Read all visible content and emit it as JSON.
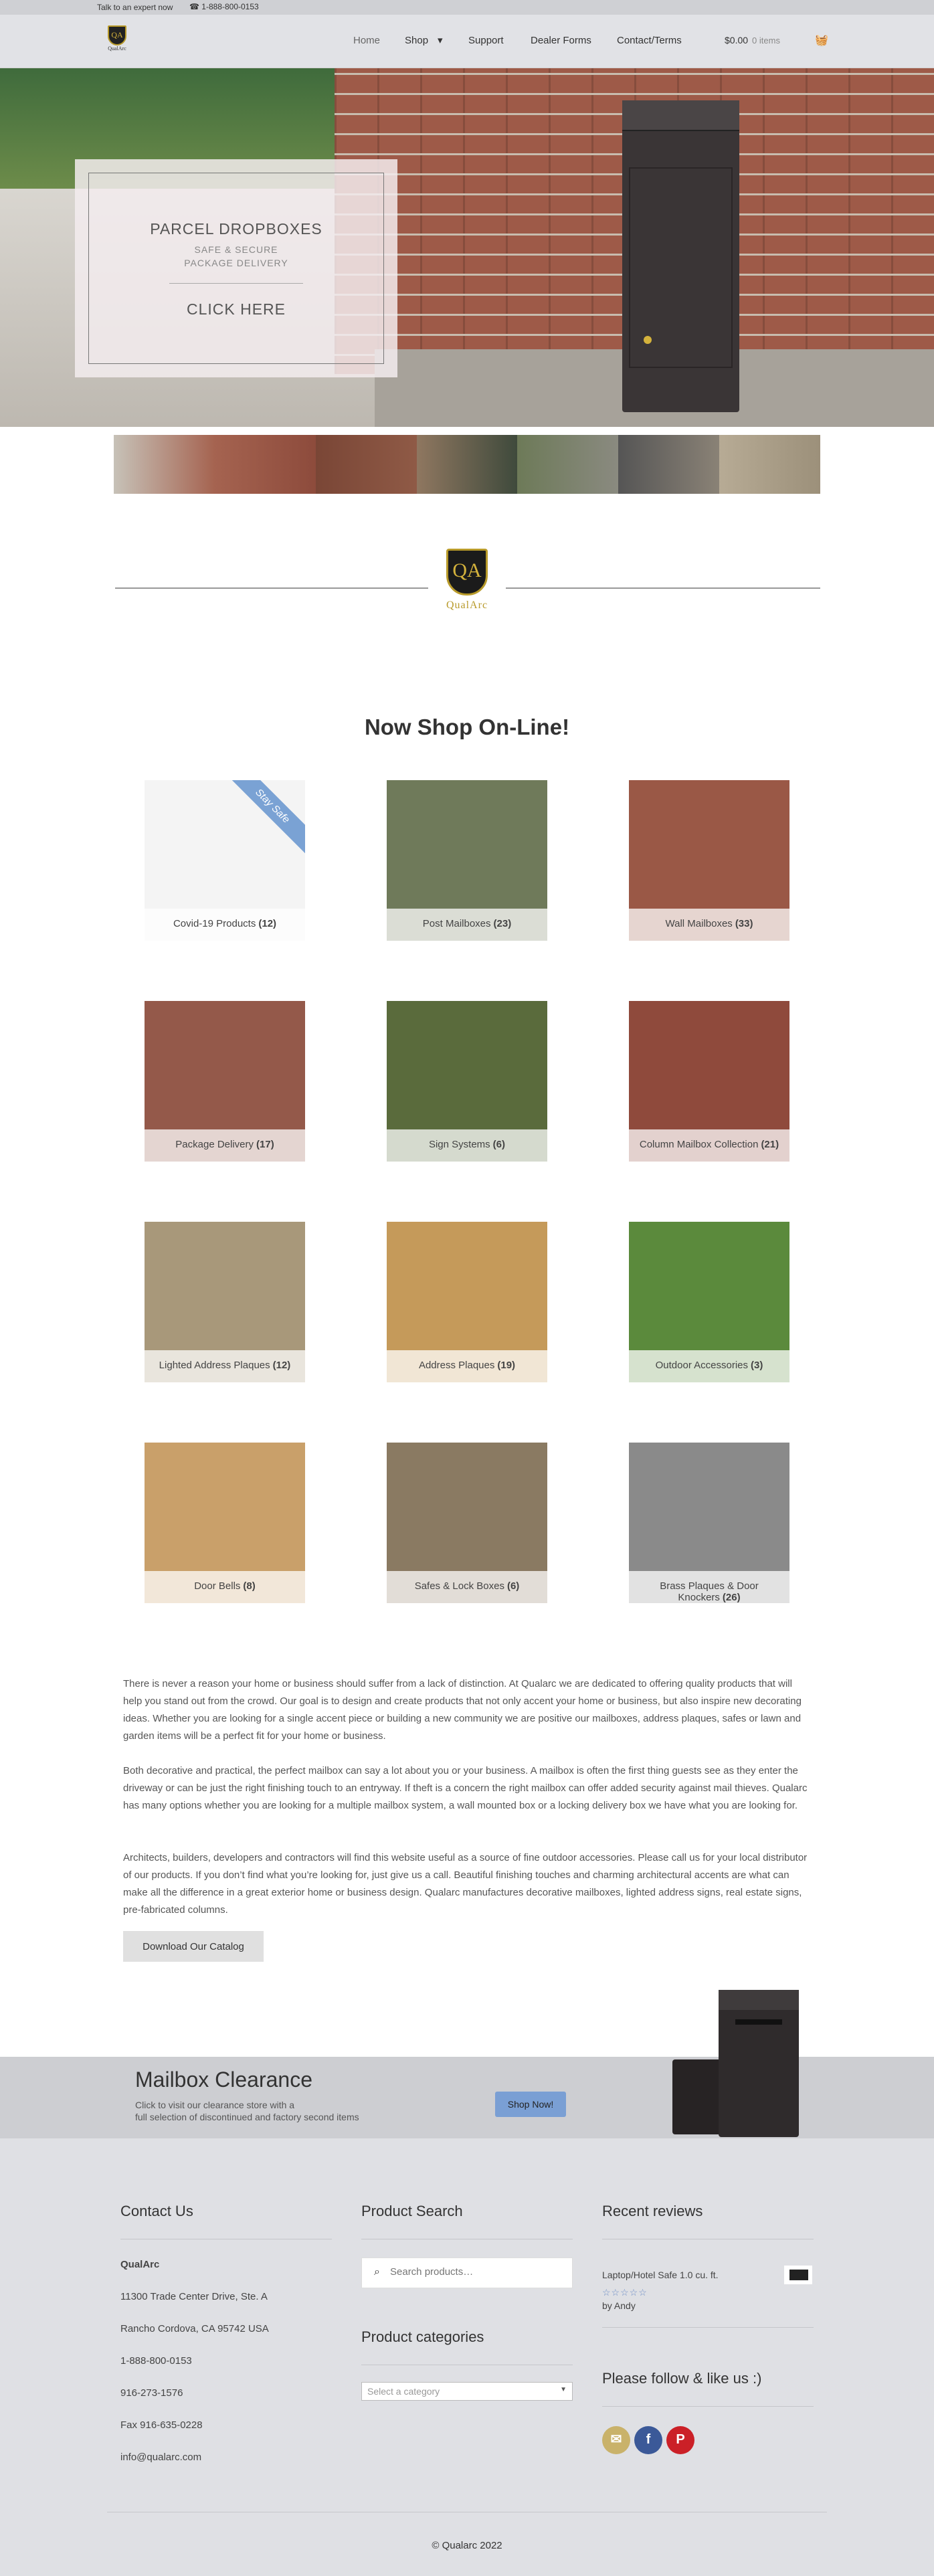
{
  "topbar": {
    "expert_text": "Talk to an expert now",
    "phone": "☎ 1-888-800-0153"
  },
  "header": {
    "logo_mark": "QA",
    "logo_name": "QualArc",
    "nav": [
      "Home",
      "Shop",
      "Support",
      "Dealer Forms",
      "Contact/Terms"
    ],
    "shop_chevron": "▾",
    "cart_amount": "$0.00",
    "cart_items": "0 items",
    "cart_icon": "🧺"
  },
  "hero": {
    "title": "PARCEL DROPBOXES",
    "subtitle1": "SAFE & SECURE",
    "subtitle2": "PACKAGE DELIVERY",
    "cta": "CLICK HERE"
  },
  "brand": {
    "mark": "QA",
    "name": "QualArc"
  },
  "shop": {
    "title": "Now Shop On-Line!",
    "categories": [
      {
        "name": "Covid-19 Products",
        "count": "(12)",
        "color": "#f4f4f4",
        "ribbon": "Stay Safe"
      },
      {
        "name": "Post Mailboxes",
        "count": "(23)",
        "color": "#6f7a5a"
      },
      {
        "name": "Wall Mailboxes",
        "count": "(33)",
        "color": "#9a5846"
      },
      {
        "name": "Package Delivery",
        "count": "(17)",
        "color": "#94594a"
      },
      {
        "name": "Sign Systems",
        "count": "(6)",
        "color": "#5a6b3c"
      },
      {
        "name": "Column Mailbox Collection",
        "count": "(21)",
        "color": "#8f4a3c"
      },
      {
        "name": "Lighted Address Plaques",
        "count": "(12)",
        "color": "#a8987a"
      },
      {
        "name": "Address Plaques",
        "count": "(19)",
        "color": "#c59a5a"
      },
      {
        "name": "Outdoor Accessories",
        "count": "(3)",
        "color": "#5b8a3c"
      },
      {
        "name": "Door Bells",
        "count": "(8)",
        "color": "#c9a06a"
      },
      {
        "name": "Safes & Lock Boxes",
        "count": "(6)",
        "color": "#8a7a62"
      },
      {
        "name": "Brass Plaques & Door Knockers",
        "count": "(26)",
        "color": "#8a8a8a"
      }
    ]
  },
  "about": {
    "p1": "There is never a reason your home or business should suffer from a lack of distinction. At Qualarc we are dedicated to offering quality products that will help you stand out from the crowd. Our goal is to design and create products that not only accent your home or business, but also inspire new decorating ideas. Whether you are looking for a single accent piece or building a new community we are positive our mailboxes, address plaques, safes or lawn and garden items will be a perfect fit for your home or business.",
    "p2": "Both decorative and practical, the perfect mailbox can say a lot about you or your business. A mailbox is often the first thing guests see as they enter the driveway or can be just the right finishing touch to an entryway. If theft is a concern the right mailbox can offer added security against mail thieves. Qualarc has many options whether you are looking for a multiple mailbox system, a wall mounted box or a locking delivery box we have what you are looking for.",
    "p3": "Architects, builders, developers and contractors will find this website useful as a source of fine outdoor accessories. Please call us for your local distributor of our products. If you don’t find what you’re looking for, just give us a call. Beautiful finishing touches and charming architectural accents are what can make all the difference in a great exterior home or business design. Qualarc manufactures decorative mailboxes, lighted address signs, real estate signs, pre-fabricated columns.",
    "catalog_button": "Download Our Catalog"
  },
  "clearance": {
    "title": "Mailbox Clearance",
    "sub1": "Click to visit our clearance store with a",
    "sub2": "full selection of discontinued and factory second items",
    "button": "Shop Now!"
  },
  "footer": {
    "contact_title": "Contact Us",
    "company": "QualArc",
    "address1": "11300 Trade Center Drive, Ste. A",
    "address2": "Rancho Cordova, CA 95742 USA",
    "phone1": "1-888-800-0153",
    "phone2": "916-273-1576",
    "fax": "Fax 916-635-0228",
    "email": "info@qualarc.com",
    "search_title": "Product Search",
    "search_placeholder": "Search products…",
    "categories_title": "Product categories",
    "category_select": "Select a category",
    "reviews_title": "Recent reviews",
    "review_product": "Laptop/Hotel Safe 1.0 cu. ft.",
    "review_stars": "☆☆☆☆☆",
    "review_author": "by Andy",
    "follow_title": "Please follow & like us :)",
    "social": [
      {
        "name": "email",
        "glyph": "✉",
        "color": "#c9b26a"
      },
      {
        "name": "facebook",
        "glyph": "f",
        "color": "#3b5998"
      },
      {
        "name": "pinterest",
        "glyph": "P",
        "color": "#cb2027"
      }
    ],
    "copyright": "© Qualarc 2022"
  }
}
